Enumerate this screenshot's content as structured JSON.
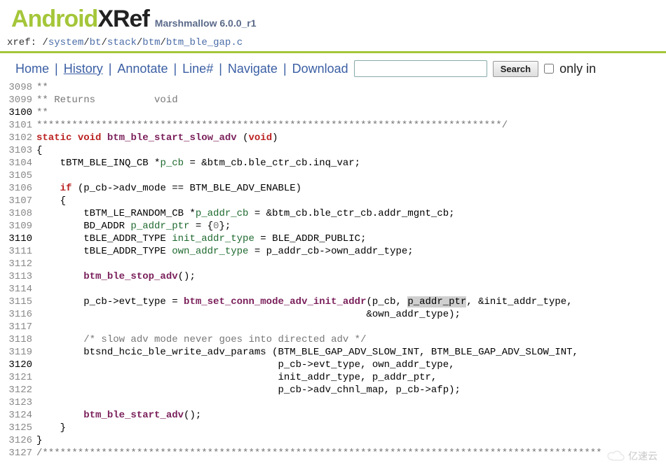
{
  "logo": {
    "and": "Android",
    "xref": "XRef"
  },
  "version": "Marshmallow 6.0.0_r1",
  "xref_label": "xref: ",
  "path": {
    "segments": [
      "/",
      "system",
      "/",
      "bt",
      "/",
      "stack",
      "/",
      "btm",
      "/",
      "btm_ble_gap.c"
    ]
  },
  "toolbar": {
    "home": "Home",
    "history": "History",
    "annotate": "Annotate",
    "linenum": "Line#",
    "navigate": "Navigate",
    "download": "Download",
    "search_btn": "Search",
    "only_in": "only in",
    "search_value": ""
  },
  "lines": [
    {
      "n": "3098",
      "mark": false,
      "html": "<span class='c'>**</span>"
    },
    {
      "n": "3099",
      "mark": false,
      "html": "<span class='c'>** Returns          void</span>"
    },
    {
      "n": "3100",
      "mark": true,
      "html": "<span class='c'>**</span>"
    },
    {
      "n": "3101",
      "mark": false,
      "html": "<span class='c'>*******************************************************************************/</span>"
    },
    {
      "n": "3102",
      "mark": false,
      "html": "<span class='kw'>static</span> <span class='kw'>void</span> <span class='fn'>btm_ble_start_slow_adv</span> (<span class='kw'>void</span>)"
    },
    {
      "n": "3103",
      "mark": false,
      "html": "{"
    },
    {
      "n": "3104",
      "mark": false,
      "html": "    tBTM_BLE_INQ_CB *<span class='var'>p_cb</span> = &amp;btm_cb.ble_ctr_cb.inq_var;"
    },
    {
      "n": "3105",
      "mark": false,
      "html": ""
    },
    {
      "n": "3106",
      "mark": false,
      "html": "    <span class='kw'>if</span> (p_cb-&gt;adv_mode == BTM_BLE_ADV_ENABLE)"
    },
    {
      "n": "3107",
      "mark": false,
      "html": "    {"
    },
    {
      "n": "3108",
      "mark": false,
      "html": "        tBTM_LE_RANDOM_CB *<span class='var'>p_addr_cb</span> = &amp;btm_cb.ble_ctr_cb.addr_mgnt_cb;"
    },
    {
      "n": "3109",
      "mark": false,
      "html": "        BD_ADDR <span class='var'>p_addr_ptr</span> = {<span class='n'>0</span>};"
    },
    {
      "n": "3110",
      "mark": true,
      "html": "        tBLE_ADDR_TYPE <span class='var'>init_addr_type</span> = BLE_ADDR_PUBLIC;"
    },
    {
      "n": "3111",
      "mark": false,
      "html": "        tBLE_ADDR_TYPE <span class='var'>own_addr_type</span> = p_addr_cb-&gt;own_addr_type;"
    },
    {
      "n": "3112",
      "mark": false,
      "html": ""
    },
    {
      "n": "3113",
      "mark": false,
      "html": "        <span class='fn'>btm_ble_stop_adv</span>();"
    },
    {
      "n": "3114",
      "mark": false,
      "html": ""
    },
    {
      "n": "3115",
      "mark": false,
      "html": "        p_cb-&gt;evt_type = <span class='fn'>btm_set_conn_mode_adv_init_addr</span>(p_cb, <span class='hl'>p_addr_ptr</span>, &amp;init_addr_type,"
    },
    {
      "n": "3116",
      "mark": false,
      "html": "                                                        &amp;own_addr_type);"
    },
    {
      "n": "3117",
      "mark": false,
      "html": ""
    },
    {
      "n": "3118",
      "mark": false,
      "html": "        <span class='c'>/* slow adv mode never goes into directed adv */</span>"
    },
    {
      "n": "3119",
      "mark": false,
      "html": "        btsnd_hcic_ble_write_adv_params (BTM_BLE_GAP_ADV_SLOW_INT, BTM_BLE_GAP_ADV_SLOW_INT,"
    },
    {
      "n": "3120",
      "mark": true,
      "html": "                                         p_cb-&gt;evt_type, own_addr_type,"
    },
    {
      "n": "3121",
      "mark": false,
      "html": "                                         init_addr_type, p_addr_ptr,"
    },
    {
      "n": "3122",
      "mark": false,
      "html": "                                         p_cb-&gt;adv_chnl_map, p_cb-&gt;afp);"
    },
    {
      "n": "3123",
      "mark": false,
      "html": ""
    },
    {
      "n": "3124",
      "mark": false,
      "html": "        <span class='fn'>btm_ble_start_adv</span>();"
    },
    {
      "n": "3125",
      "mark": false,
      "html": "    }"
    },
    {
      "n": "3126",
      "mark": false,
      "html": "}"
    },
    {
      "n": "3127",
      "mark": false,
      "html": "<span class='c'>/***********************************************************************************************</span>"
    }
  ],
  "watermark": "亿速云"
}
